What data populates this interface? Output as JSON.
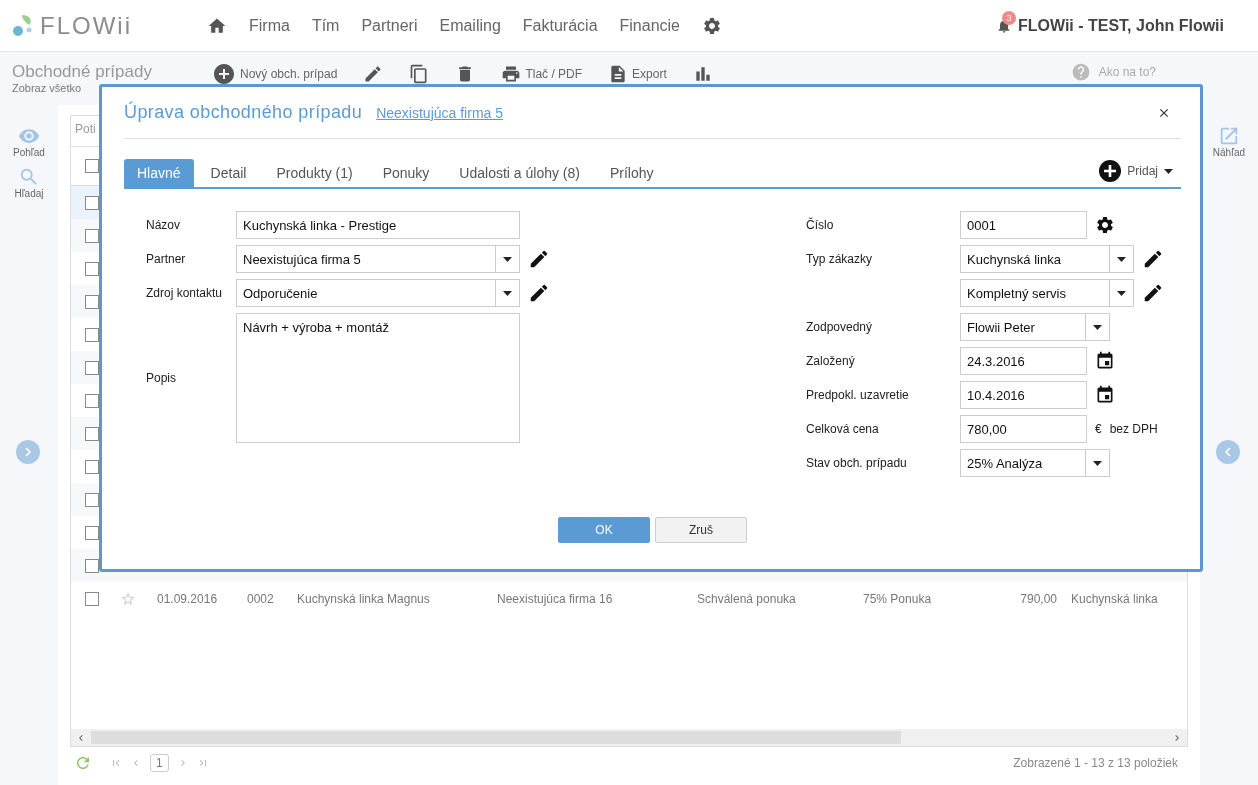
{
  "app": {
    "logo": "FLOWii",
    "nav": [
      {
        "kind": "home"
      },
      {
        "kind": "link",
        "label": "Firma"
      },
      {
        "kind": "link",
        "label": "Tím"
      },
      {
        "kind": "link",
        "label": "Partneri"
      },
      {
        "kind": "link",
        "label": "Emailing"
      },
      {
        "kind": "link",
        "label": "Fakturácia"
      },
      {
        "kind": "link",
        "label": "Financie"
      },
      {
        "kind": "settings"
      }
    ],
    "notifications": "3",
    "user": "FLOWii - TEST, John Flowii"
  },
  "page": {
    "title": "Obchodné prípady",
    "subtitle": "Zobraz všetko",
    "toolbar": [
      {
        "kind": "add",
        "label": "Nový obch. prípad"
      },
      {
        "kind": "edit"
      },
      {
        "kind": "copy"
      },
      {
        "kind": "delete"
      },
      {
        "kind": "print",
        "label": "Tlač / PDF"
      },
      {
        "kind": "export",
        "label": "Export"
      },
      {
        "kind": "chart"
      }
    ],
    "help": "Ako na to?"
  },
  "left_sidebar": [
    {
      "kind": "view",
      "label": "Pohľad"
    },
    {
      "kind": "search",
      "label": "Hľadaj"
    }
  ],
  "right_sidebar": [
    {
      "kind": "preview",
      "label": "Náhľad"
    }
  ],
  "grid": {
    "group_panel": "Poti",
    "select_all_checked": false,
    "rows": [
      {
        "checked": false,
        "selected": true
      },
      {
        "checked": false,
        "selected": false
      },
      {
        "checked": false,
        "selected": false
      },
      {
        "checked": false,
        "selected": false
      },
      {
        "checked": false,
        "selected": false
      },
      {
        "checked": false,
        "selected": false
      },
      {
        "checked": false,
        "selected": false
      },
      {
        "checked": false,
        "selected": false
      },
      {
        "checked": false,
        "selected": false
      },
      {
        "checked": false,
        "selected": false
      },
      {
        "checked": false,
        "selected": false
      },
      {
        "checked": false,
        "selected": false
      },
      {
        "checked": false,
        "selected": false,
        "starred": false,
        "cells": [
          "01.09.2016",
          "0002",
          "Kuchynská linka Magnus",
          "Neexistujúca firma 16",
          "Schválená ponuka",
          "75% Ponuka",
          "790,00",
          "Kuchynská linka"
        ]
      }
    ],
    "pager": [
      {
        "kind": "first"
      },
      {
        "kind": "prev"
      },
      {
        "kind": "page",
        "label": "1",
        "selected": true
      },
      {
        "kind": "next"
      },
      {
        "kind": "last"
      }
    ],
    "summary": "Zobrazené 1 - 13 z 13 položiek"
  },
  "dialog": {
    "title": "Úprava obchodného prípadu",
    "link": "Neexistujúca firma 5",
    "tabs": [
      {
        "label": "Hlavné",
        "selected": true
      },
      {
        "label": "Detail",
        "selected": false
      },
      {
        "label": "Produkty (1)",
        "selected": false
      },
      {
        "label": "Ponuky",
        "selected": false
      },
      {
        "label": "Udalosti a úlohy (8)",
        "selected": false
      },
      {
        "label": "Prílohy",
        "selected": false
      }
    ],
    "add": "Pridaj",
    "left_fields": [
      {
        "label": "Názov",
        "kind": "text",
        "value": "Kuchynská linka - Prestige"
      },
      {
        "label": "Partner",
        "kind": "select",
        "value": "Neexistujúca firma 5",
        "tool": {
          "kind": "edit"
        }
      },
      {
        "label": "Zdroj kontaktu",
        "kind": "select",
        "value": "Odporučenie",
        "tool": {
          "kind": "edit"
        }
      },
      {
        "label": "Popis",
        "kind": "textarea",
        "value": "Návrh + výroba + montáž"
      }
    ],
    "right_fields": [
      {
        "label": "Číslo",
        "kind": "text",
        "value": "0001",
        "tool": {
          "kind": "settings"
        }
      },
      {
        "label": "Typ zákazky",
        "kind": "select",
        "value": "Kuchynská linka",
        "tool": {
          "kind": "edit"
        }
      },
      {
        "kind": "select",
        "value": "Kompletný servis",
        "tool": {
          "kind": "edit"
        }
      },
      {
        "label": "Zodpovedný",
        "kind": "select",
        "value": "Flowii Peter"
      },
      {
        "label": "Založený",
        "kind": "text",
        "value": "24.3.2016",
        "tool": {
          "kind": "calendar"
        }
      },
      {
        "label": "Predpokl. uzavretie",
        "kind": "text",
        "value": "10.4.2016",
        "tool": {
          "kind": "calendar"
        }
      },
      {
        "label": "Celková cena",
        "kind": "text",
        "value": "780,00",
        "currency": "€",
        "unit": "bez DPH"
      },
      {
        "label": "Stav obch. prípadu",
        "kind": "select",
        "value": "25% Analýza"
      }
    ],
    "buttons": [
      {
        "kind": "primary",
        "label": "OK"
      },
      {
        "kind": "secondary",
        "label": "Zruš"
      }
    ]
  }
}
